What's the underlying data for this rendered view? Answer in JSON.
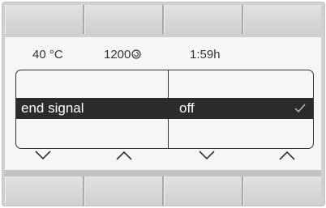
{
  "status": {
    "temperature": "40 °C",
    "spin_speed": "1200",
    "time_remaining": "1:59h"
  },
  "settings": {
    "selected_setting": "end signal",
    "selected_value": "off"
  },
  "controls": {
    "arrows": [
      "down",
      "up",
      "down",
      "up"
    ]
  },
  "icons": {
    "spin": "spin-icon",
    "check": "check-icon"
  }
}
